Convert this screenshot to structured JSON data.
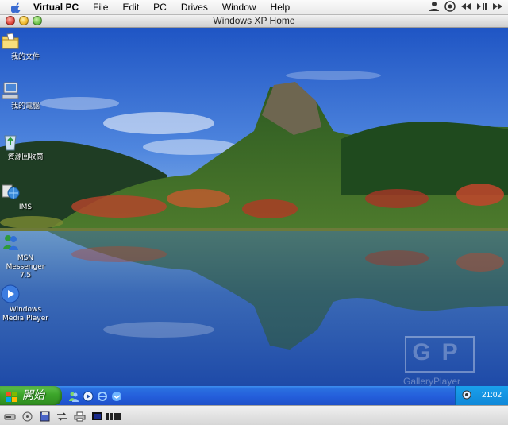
{
  "menubar": {
    "app_name": "Virtual PC",
    "items": [
      "File",
      "Edit",
      "PC",
      "Drives",
      "Window",
      "Help"
    ]
  },
  "window": {
    "title": "Windows XP Home"
  },
  "desktop": {
    "icons": [
      {
        "label": "我的文件",
        "icon": "my-documents-icon"
      },
      {
        "label": "我的電腦",
        "icon": "my-computer-icon"
      },
      {
        "label": "資源回收筒",
        "icon": "recycle-bin-icon"
      },
      {
        "label": "IMS",
        "icon": "ims-icon"
      },
      {
        "label": "MSN Messenger 7.5",
        "icon": "msn-messenger-icon"
      },
      {
        "label": "Windows Media Player",
        "icon": "media-player-icon"
      }
    ],
    "watermark": {
      "letters": "GP",
      "text": "GalleryPlayer"
    }
  },
  "taskbar": {
    "start_label": "開始",
    "quick_launch": [
      "msn-messenger-icon",
      "media-player-icon",
      "internet-explorer-icon",
      "outlook-express-icon"
    ],
    "clock": "21:02"
  },
  "statusbar": {
    "items": [
      "hard-disk-icon",
      "cd-drive-icon",
      "floppy-icon",
      "network-icon",
      "printer-icon",
      "display-icon",
      "performance-meter-icon"
    ]
  },
  "colors": {
    "taskbar_blue": "#245edb",
    "start_green": "#3ca52a",
    "tray_blue": "#0f88d8"
  }
}
